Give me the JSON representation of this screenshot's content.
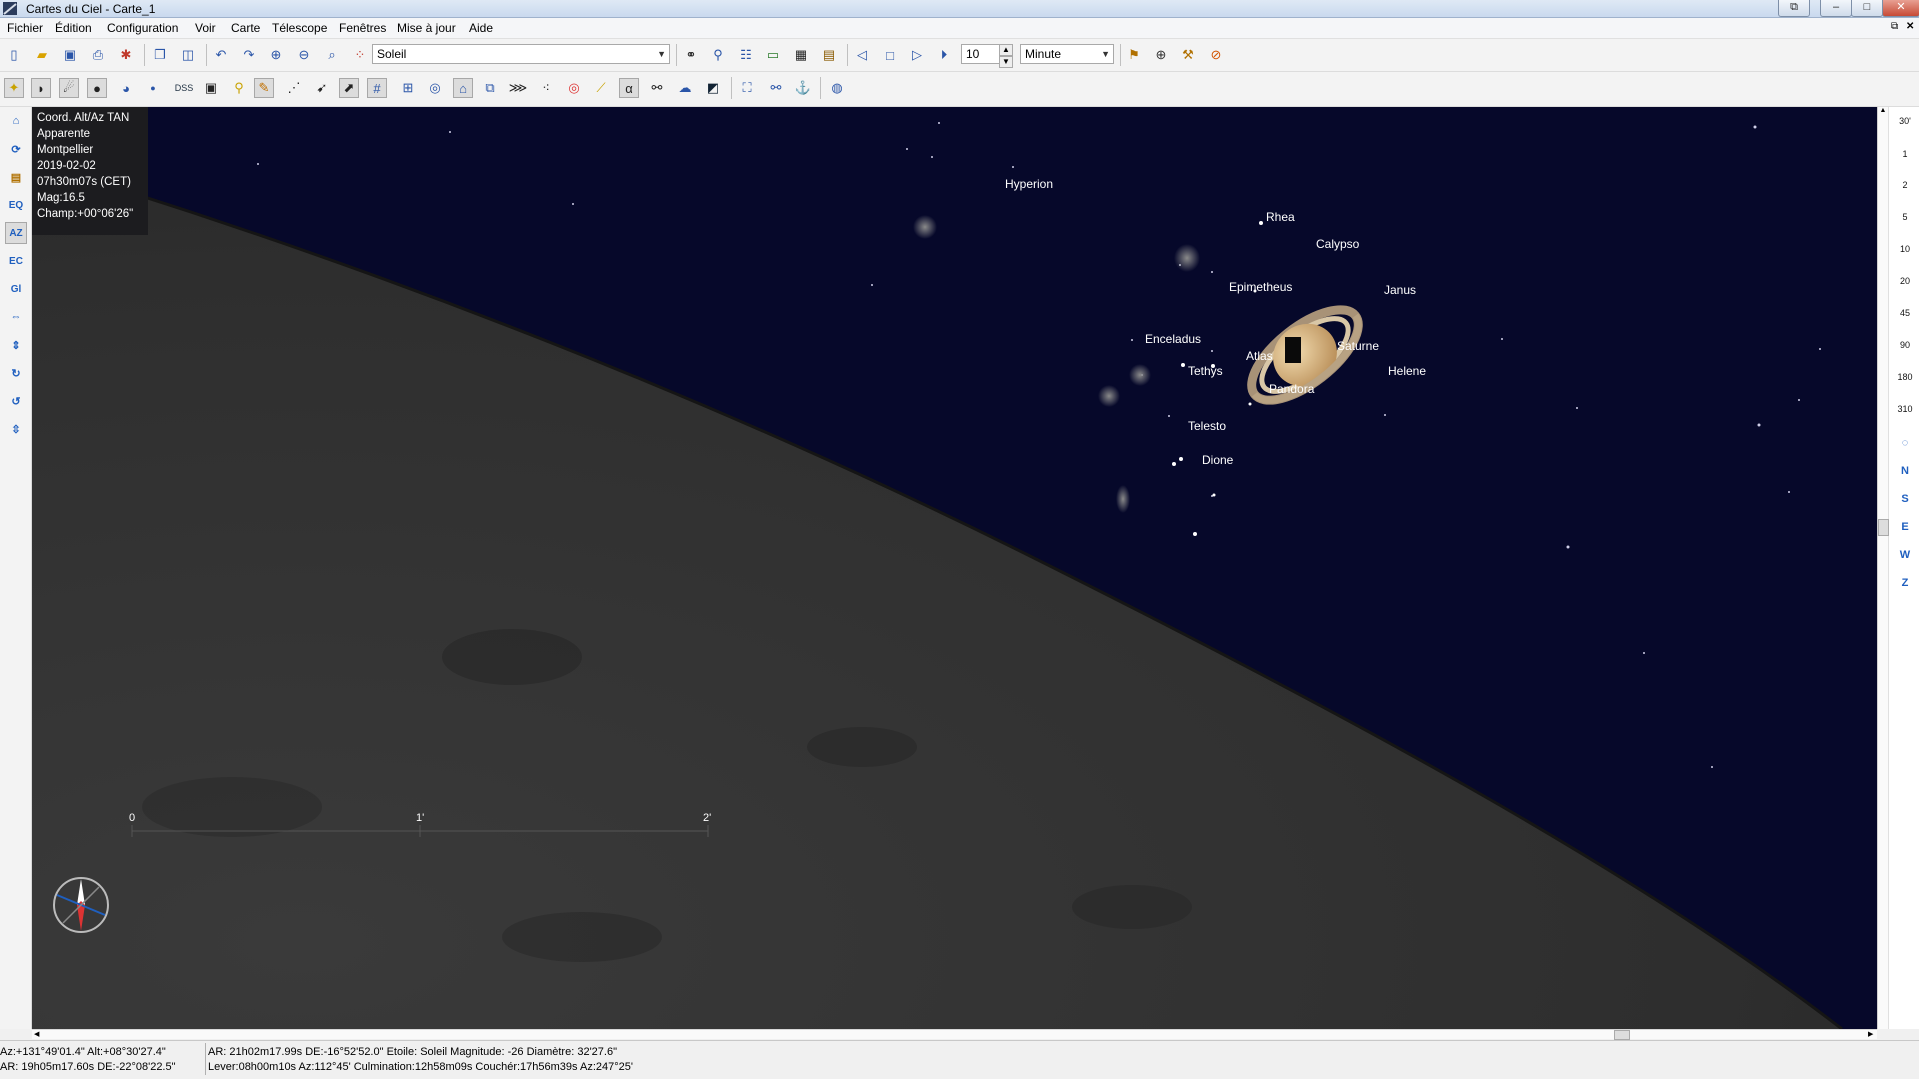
{
  "window": {
    "title": "Cartes du Ciel - Carte_1",
    "buttons": {
      "restore": "⧉",
      "minimize": "–",
      "maximize": "□",
      "close": "✕"
    }
  },
  "menu": [
    "Fichier",
    "Édition",
    "Configuration",
    "Voir",
    "Carte",
    "Télescope",
    "Fenêtres",
    "Mise à jour",
    "Aide"
  ],
  "toolbar": {
    "object_search_value": "Soleil",
    "time_step_value": "10",
    "time_unit_value": "Minute",
    "dss_label": "DSS",
    "alpha_label": "α"
  },
  "left_toolbar": {
    "eq_label": "EQ",
    "az_label": "AZ",
    "ec_label": "EC",
    "gl_label": "Gl"
  },
  "right_scale": {
    "fov_values": [
      "30'",
      "1",
      "2",
      "5",
      "10",
      "20",
      "45",
      "90",
      "180",
      "310"
    ],
    "directions": [
      "N",
      "S",
      "E",
      "W",
      "Z"
    ]
  },
  "info_panel": {
    "lines": [
      "Coord. Alt/Az TAN",
      "Apparente",
      "Montpellier",
      "2019-02-02",
      "07h30m07s (CET)",
      "Mag:16.5",
      "Champ:+00°06'26\""
    ]
  },
  "sky_labels": [
    {
      "name": "Hyperion"
    },
    {
      "name": "Rhea"
    },
    {
      "name": "Calypso"
    },
    {
      "name": "Epimetheus"
    },
    {
      "name": "Janus"
    },
    {
      "name": "Enceladus"
    },
    {
      "name": "Atlas"
    },
    {
      "name": "Saturne"
    },
    {
      "name": "Tethys"
    },
    {
      "name": "Helene"
    },
    {
      "name": "Pandora"
    },
    {
      "name": "Telesto"
    },
    {
      "name": "Dione"
    }
  ],
  "scale_bar": [
    "0",
    "1'",
    "2'"
  ],
  "status": {
    "line1_left": "Az:+131°49'01.4\"  Alt:+08°30'27.4\"",
    "line2_left": "AR: 19h05m17.60s DE:-22°08'22.5\"",
    "line1_right": "AR: 21h02m17.99s DE:-16°52'52.0\"  Etoile: Soleil  Magnitude: -26  Diamètre: 32'27.6\"",
    "line2_right": "Lever:08h00m10s Az:112°45'  Culmination:12h58m09s  Couchér:17h56m39s  Az:247°25'"
  }
}
